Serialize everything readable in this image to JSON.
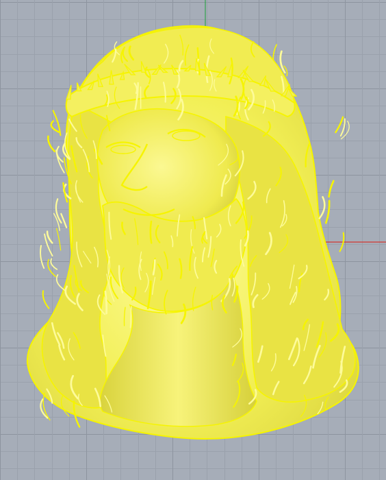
{
  "viewport": {
    "view_name": "",
    "background": "#a6adb8",
    "grid_minor_color": "#9aa1ac",
    "grid_major_color": "#8d949f",
    "x_axis_color": "#d4352e",
    "y_axis_color": "#33a34d",
    "object": {
      "name": "",
      "icon": "relief-model-icon",
      "fill_color": "#f2ef55",
      "highlight_color": "#fdfb9a",
      "edge_color": "#f6f400",
      "shadow_color": "#b9b32e",
      "selected": true
    }
  }
}
